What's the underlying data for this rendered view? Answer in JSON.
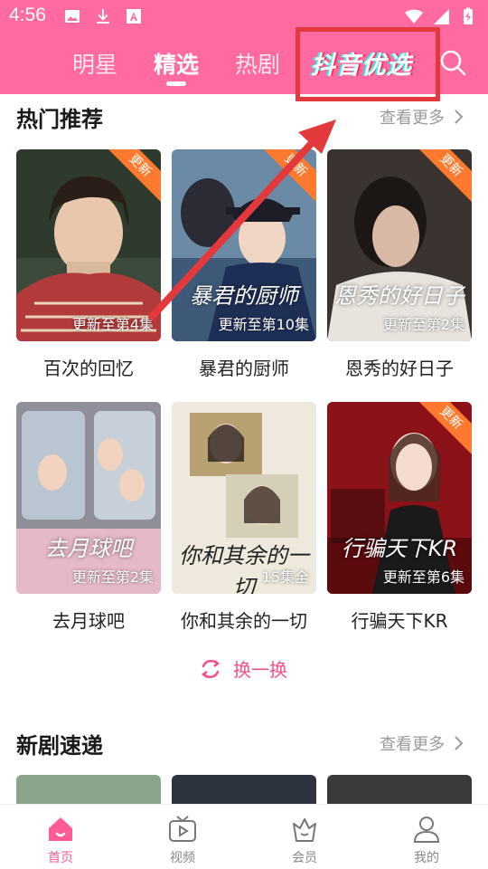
{
  "status": {
    "time": "4:56"
  },
  "tabs": [
    {
      "label": "明星"
    },
    {
      "label": "精选"
    },
    {
      "label": "热剧"
    },
    {
      "label": "抖音优选"
    }
  ],
  "sections": {
    "hot": {
      "title": "热门推荐",
      "more": "查看更多"
    },
    "new": {
      "title": "新剧速递",
      "more": "查看更多"
    }
  },
  "cards": [
    {
      "title": "百次的回忆",
      "episode": "更新至第4集",
      "badge": "更新",
      "caption": ""
    },
    {
      "title": "暴君的厨师",
      "episode": "更新至第10集",
      "badge": "更新",
      "caption": "暴君的厨师"
    },
    {
      "title": "恩秀的好日子",
      "episode": "更新至第2集",
      "badge": "更新",
      "caption": "恩秀的好日子"
    },
    {
      "title": "去月球吧",
      "episode": "更新至第2集",
      "badge": "",
      "caption": "去月球吧"
    },
    {
      "title": "你和其余的一切",
      "episode": "15集全",
      "badge": "",
      "caption": "你和其余的一切"
    },
    {
      "title": "行骗天下KR",
      "episode": "更新至第6集",
      "badge": "更新",
      "caption": "行骗天下KR"
    }
  ],
  "refresh_label": "换一换",
  "bottom_nav": [
    {
      "label": "首页"
    },
    {
      "label": "视频"
    },
    {
      "label": "会员"
    },
    {
      "label": "我的"
    }
  ],
  "colors": {
    "brand_pink": "#ff6aa0",
    "highlight_red": "#e4393c",
    "update_orange": "#ff7a2e",
    "active_pink": "#ff5c93"
  }
}
